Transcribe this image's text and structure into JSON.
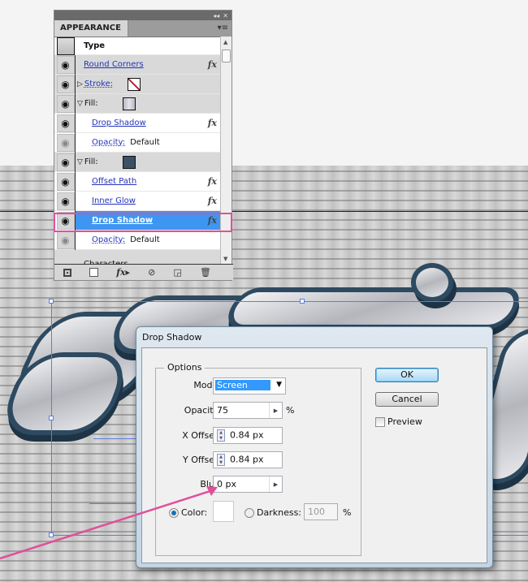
{
  "panel": {
    "tab": "APPEARANCE",
    "header": "Type",
    "rows": [
      {
        "label": "Round Corners",
        "fx": "fx",
        "type": "effect"
      },
      {
        "label": "Stroke:",
        "type": "stroke"
      },
      {
        "label": "Fill:",
        "type": "fill",
        "swatch": "#c8c8d2"
      },
      {
        "label": "Drop Shadow",
        "fx": "fx",
        "type": "effect"
      },
      {
        "label": "Opacity:",
        "value": "Default",
        "type": "opacity"
      },
      {
        "label": "Fill:",
        "type": "fill",
        "swatch": "#3a5168"
      },
      {
        "label": "Offset Path",
        "fx": "fx",
        "type": "effect"
      },
      {
        "label": "Inner Glow",
        "fx": "fx",
        "type": "effect"
      },
      {
        "label": "Drop Shadow",
        "fx": "fx",
        "type": "effect",
        "selected": true
      },
      {
        "label": "Opacity:",
        "value": "Default",
        "type": "opacity"
      }
    ],
    "footer_item": "Characters",
    "bottom_icons": [
      "square-icon",
      "new-fill-icon",
      "fx-icon",
      "clear-icon",
      "duplicate-icon",
      "trash-icon"
    ]
  },
  "dialog": {
    "title": "Drop Shadow",
    "group_title": "Options",
    "mode_label": "Mode:",
    "mode_value": "Screen",
    "opacity_label": "Opacity:",
    "opacity_value": "75",
    "opacity_unit": "%",
    "xoffset_label": "X Offset:",
    "xoffset_value": "0.84 px",
    "yoffset_label": "Y Offset:",
    "yoffset_value": "0.84 px",
    "blur_label": "Blur:",
    "blur_value": "0 px",
    "color_label": "Color:",
    "color_value": "#ffffff",
    "darkness_label": "Darkness:",
    "darkness_value": "100",
    "darkness_unit": "%",
    "ok_label": "OK",
    "cancel_label": "Cancel",
    "preview_label": "Preview",
    "preview_checked": false,
    "color_selected": true
  },
  "colors": {
    "highlight": "#e0509a",
    "selection": "#3d96f2"
  }
}
